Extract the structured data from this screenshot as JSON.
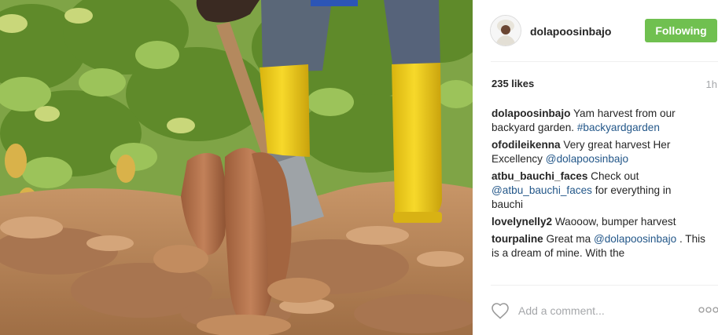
{
  "post": {
    "username": "dolapoosinbajo",
    "follow_label": "Following",
    "likes": "235 likes",
    "time_ago": "1h",
    "caption": {
      "user": "dolapoosinbajo",
      "text": " Yam harvest from our backyard garden. ",
      "hashtag": "#backyardgarden"
    },
    "comments": [
      {
        "user": "ofodileikenna",
        "text": " Very great harvest Her Excellency ",
        "mention": "@dolapoosinbajo",
        "tail": ""
      },
      {
        "user": "atbu_bauchi_faces",
        "text": " Check out ",
        "mention": "@atbu_bauchi_faces",
        "tail": " for everything in bauchi"
      },
      {
        "user": "lovelynelly2",
        "text": " Waooow, bumper harvest",
        "mention": "",
        "tail": ""
      },
      {
        "user": "tourpaline",
        "text": " Great ma ",
        "mention": "@dolapoosinbajo",
        "tail": " . This is a dream of mine. With the"
      }
    ],
    "add_comment_placeholder": "Add a comment..."
  },
  "icons": {
    "like": "heart-outline-icon",
    "options": "ellipsis-icon",
    "avatar": "profile-avatar"
  },
  "colors": {
    "follow_button": "#70c050",
    "link": "#235789",
    "muted": "#a5a7aa",
    "boots": "#f2cf1c",
    "jeans": "#566577",
    "soil": "#b7865a",
    "foliage": "#6f9a2f"
  }
}
